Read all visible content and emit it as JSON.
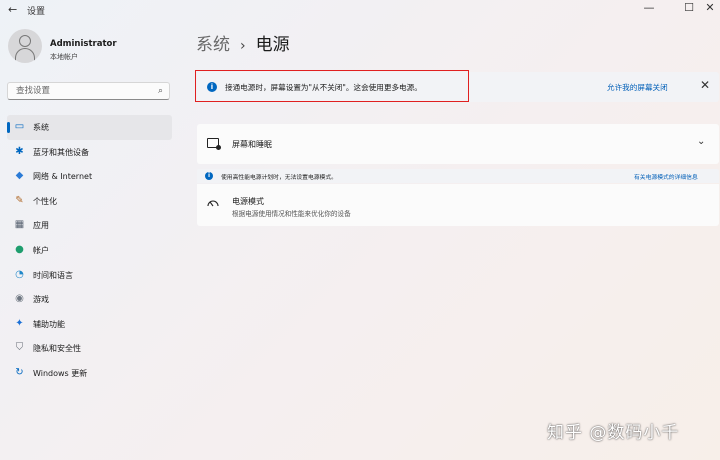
{
  "window": {
    "title": "设置",
    "back_icon": "←",
    "minimize_icon": "—",
    "maximize_icon": "☐",
    "close_icon": "✕"
  },
  "profile": {
    "name": "Administrator",
    "account_type": "本地帐户"
  },
  "search": {
    "placeholder": "查找设置",
    "icon": "⌕"
  },
  "nav": {
    "items": [
      {
        "label": "系统",
        "icon": "▭",
        "color": "#0067c0"
      },
      {
        "label": "蓝牙和其他设备",
        "icon": "✱",
        "color": "#0067c0"
      },
      {
        "label": "网络 & Internet",
        "icon": "◆",
        "color": "#2b7bd6"
      },
      {
        "label": "个性化",
        "icon": "✎",
        "color": "#b06a2a"
      },
      {
        "label": "应用",
        "icon": "▦",
        "color": "#55606e"
      },
      {
        "label": "帐户",
        "icon": "●",
        "color": "#1f9e6e"
      },
      {
        "label": "时间和语言",
        "icon": "◔",
        "color": "#1f87c9"
      },
      {
        "label": "游戏",
        "icon": "◉",
        "color": "#6e7681"
      },
      {
        "label": "辅助功能",
        "icon": "✦",
        "color": "#1a6fd6"
      },
      {
        "label": "隐私和安全性",
        "icon": "⛉",
        "color": "#6a6f78"
      },
      {
        "label": "Windows 更新",
        "icon": "↻",
        "color": "#0067c0"
      }
    ]
  },
  "breadcrumb": {
    "parent": "系统",
    "separator": "›",
    "current": "电源"
  },
  "info_bar": {
    "icon": "i",
    "text": "接通电源时，屏幕设置为\"从不关闭\"。这会使用更多电源。",
    "link": "允许我的屏幕关闭",
    "close_icon": "✕"
  },
  "screen_sleep": {
    "label": "屏幕和睡眠",
    "chevron": "⌄"
  },
  "notice": {
    "icon": "i",
    "text": "使用高性能电源计划时，无法设置电源模式。",
    "link": "有关电源模式的详细信息"
  },
  "power_mode": {
    "title": "电源模式",
    "description": "根据电源使用情况和性能来优化你的设备"
  },
  "watermark": {
    "text": "知乎 @数码小千"
  }
}
